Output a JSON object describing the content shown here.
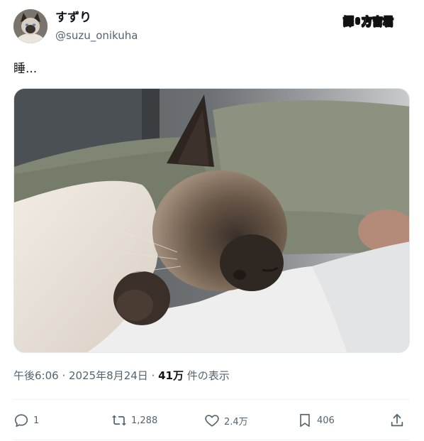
{
  "author": {
    "display_name": "すずり",
    "handle": "@suzu_onikuha"
  },
  "watermark": {
    "left": "譯",
    "right": "方吉君"
  },
  "tweet": {
    "text": "睡..."
  },
  "meta": {
    "time": "午後6:06",
    "separator1": " · ",
    "date": "2025年8月24日",
    "separator2": " · ",
    "views": "41万",
    "views_suffix": " 件の表示"
  },
  "actions": {
    "reply": {
      "icon": "reply-icon",
      "count": "1"
    },
    "retweet": {
      "icon": "retweet-icon",
      "count": "1,288"
    },
    "like": {
      "icon": "heart-icon",
      "count": "2.4万"
    },
    "bookmark": {
      "icon": "bookmark-icon",
      "count": "406"
    },
    "share": {
      "icon": "share-icon"
    }
  },
  "colors": {
    "text_primary": "#0f1419",
    "text_secondary": "#536471",
    "divider": "#eff3f4"
  }
}
